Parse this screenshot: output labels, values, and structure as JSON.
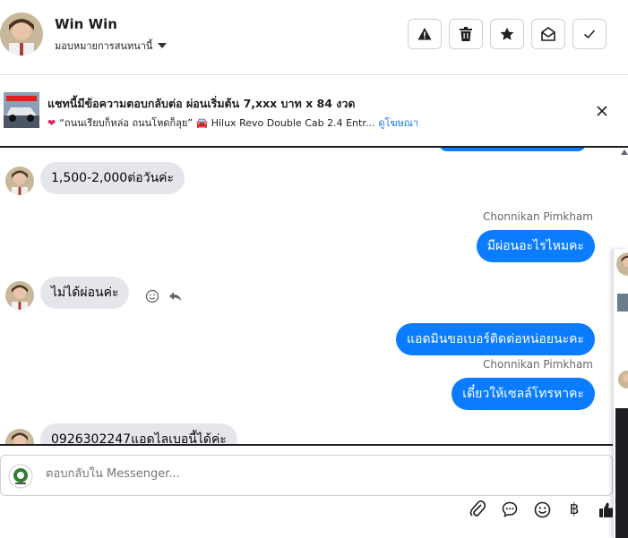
{
  "header": {
    "contact_name": "Win Win",
    "assign_label": "มอบหมายการสนทนานี้",
    "actions": [
      {
        "name": "mark-spam",
        "icon": "warning-icon"
      },
      {
        "name": "delete",
        "icon": "trash-icon"
      },
      {
        "name": "star",
        "icon": "star-icon"
      },
      {
        "name": "mark-unread",
        "icon": "envelope-open-icon"
      },
      {
        "name": "mark-done",
        "icon": "check-icon"
      }
    ]
  },
  "ad_banner": {
    "title": "แชทนี้มีข้อความตอบกลับต่อ ผ่อนเริ่มต้น 7,xxx บาท x 84 งวด",
    "subtitle": "“ถนนเรียบก็หล่อ ถนนโหดก็ลุย” 🚘 Hilux Revo Double Cab 2.4 Entr...",
    "link_label": "ดูโฆษณา"
  },
  "messages": [
    {
      "direction": "in",
      "text": "1,500-2,000ต่อวันค่ะ"
    },
    {
      "direction": "out",
      "sender": "Chonnikan Pimkham",
      "text": "มีผ่อนอะไรไหมคะ"
    },
    {
      "direction": "in",
      "text": "ไม่ได้ผ่อนค่ะ"
    },
    {
      "direction": "out",
      "text": "แอดมินขอเบอร์ติดต่อหน่อยนะคะ"
    },
    {
      "direction": "out",
      "sender": "Chonnikan Pimkham",
      "text": "เดี๋ยวให้เซลล์โทรหาคะ"
    },
    {
      "direction": "in",
      "text": "0926302247แอดไลเบอนี้ได้ค่ะ"
    }
  ],
  "composer": {
    "placeholder": "ตอบกลับใน Messenger...",
    "tools": [
      "paperclip-icon",
      "chat-bubble-icon",
      "emoji-icon",
      "baht-icon",
      "thumbs-up-icon"
    ],
    "baht_symbol": "฿"
  },
  "colors": {
    "outgoing_bubble": "#0a7cff",
    "incoming_bubble": "#e4e6eb",
    "link": "#1877f2"
  }
}
